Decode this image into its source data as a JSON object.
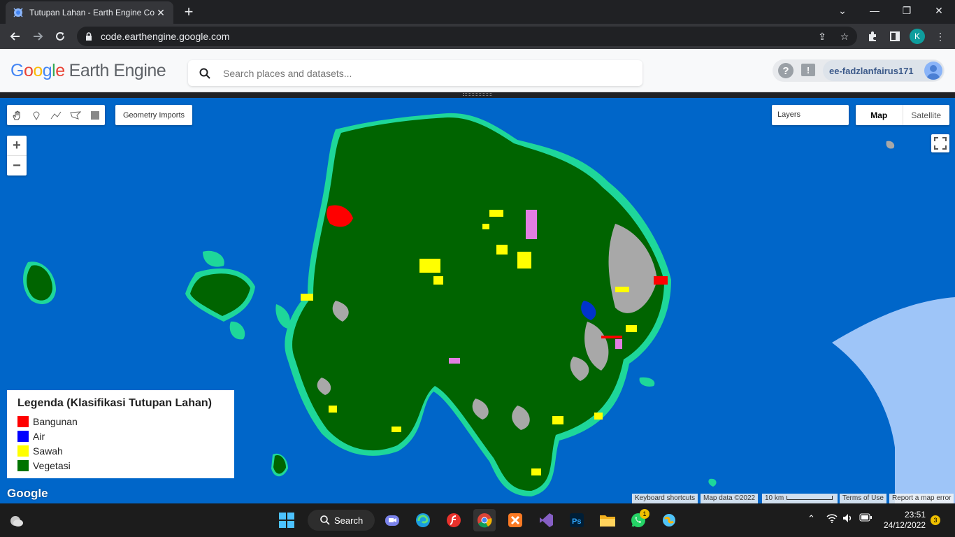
{
  "browser": {
    "tab_title": "Tutupan Lahan - Earth Engine Co",
    "url": "code.earthengine.google.com",
    "profile_initial": "K"
  },
  "header": {
    "logo_google": [
      "G",
      "o",
      "o",
      "g",
      "l",
      "e"
    ],
    "logo_product": "Earth Engine",
    "search_placeholder": "Search places and datasets...",
    "account_name": "ee-fadzlanfairus171"
  },
  "map": {
    "geometry_imports_label": "Geometry Imports",
    "layers_label": "Layers",
    "map_type_map": "Map",
    "map_type_satellite": "Satellite",
    "zoom_in": "+",
    "zoom_out": "−",
    "google_logo": "Google",
    "attribution": {
      "shortcuts": "Keyboard shortcuts",
      "map_data": "Map data ©2022",
      "scale": "10 km",
      "terms": "Terms of Use",
      "report": "Report a map error"
    },
    "legend": {
      "title": "Legenda (Klasifikasi Tutupan Lahan)",
      "items": [
        {
          "label": "Bangunan",
          "color": "#ff0000"
        },
        {
          "label": "Air",
          "color": "#0000ff"
        },
        {
          "label": "Sawah",
          "color": "#ffff00"
        },
        {
          "label": "Vegetasi",
          "color": "#007300"
        }
      ]
    },
    "colors": {
      "ocean": "#0066c9",
      "vegetation": "#006400",
      "coast": "#1ed79a",
      "bare": "#a8a8a8",
      "sea_light": "#9ec5f8"
    }
  },
  "taskbar": {
    "search_label": "Search",
    "time": "23:51",
    "date": "24/12/2022",
    "whatsapp_badge": "1",
    "notification_count": "3"
  }
}
